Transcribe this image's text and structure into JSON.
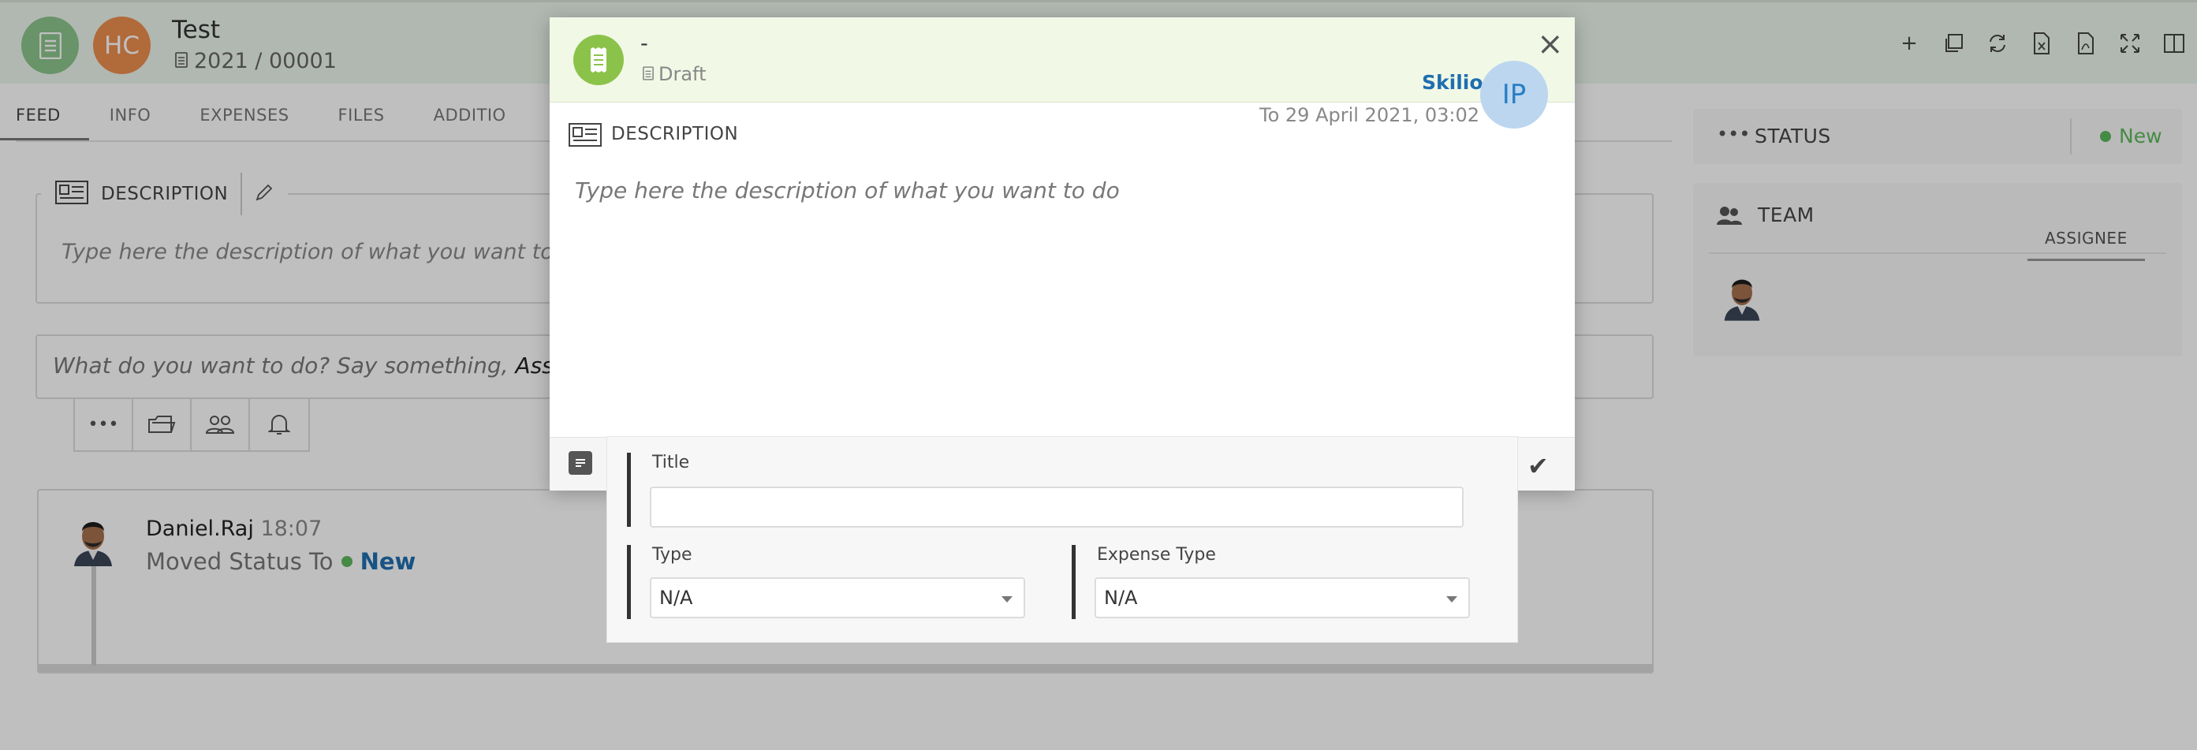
{
  "header": {
    "title": "Test",
    "number": "2021 / 00001",
    "owner_initials": "HC",
    "toolbar": [
      "add-icon",
      "duplicate-icon",
      "refresh-icon",
      "excel-icon",
      "pdf-icon",
      "expand-icon",
      "split-view-icon"
    ]
  },
  "tabs": [
    "FEED",
    "INFO",
    "EXPENSES",
    "FILES",
    "ADDITIO"
  ],
  "description": {
    "label": "DESCRIPTION",
    "placeholder": "Type here the description of what you want to d"
  },
  "compose": {
    "placeholder_prefix": "What do you want to do? Say something, ",
    "placeholder_bold": "Assig"
  },
  "feed": {
    "author": "Daniel.Raj",
    "time": "18:07",
    "message": "Moved Status To",
    "status": "New"
  },
  "status_card": {
    "title": "STATUS",
    "value": "New"
  },
  "team_card": {
    "title": "TEAM",
    "tab": "ASSIGNEE"
  },
  "modal": {
    "title": "-",
    "status": "Draft",
    "company": "Skilio",
    "assignee_initials": "IP",
    "deadline": "To 29 April 2021, 03:02",
    "description_label": "DESCRIPTION",
    "description_placeholder": "Type here the description of what you want to do"
  },
  "form": {
    "title_label": "Title",
    "title_value": "",
    "type_label": "Type",
    "type_value": "N/A",
    "expense_type_label": "Expense Type",
    "expense_type_value": "N/A"
  },
  "colors": {
    "header_bg": "#edf6ed",
    "modal_header_bg": "#f1f8e6",
    "accent_green": "#8bc34a",
    "status_green": "#5cb85c",
    "link_blue": "#1f6fb0"
  }
}
